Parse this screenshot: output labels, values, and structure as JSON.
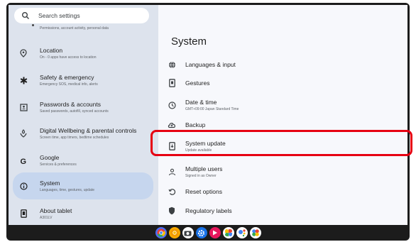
{
  "search": {
    "placeholder": "Search settings"
  },
  "left": {
    "cut_subtitle": "Permissions, account activity, personal data",
    "items": [
      {
        "title": "Location",
        "subtitle": "On - 0 apps have access to location",
        "icon": "location-pin-icon"
      },
      {
        "title": "Safety & emergency",
        "subtitle": "Emergency SOS, medical info, alerts",
        "icon": "asterisk-icon"
      },
      {
        "title": "Passwords & accounts",
        "subtitle": "Saved passwords, autofill, synced accounts",
        "icon": "account-box-icon"
      },
      {
        "title": "Digital Wellbeing & parental controls",
        "subtitle": "Screen time, app timers, bedtime schedules",
        "icon": "wellbeing-icon"
      },
      {
        "title": "Google",
        "subtitle": "Services & preferences",
        "icon": "google-icon"
      },
      {
        "title": "System",
        "subtitle": "Languages, time, gestures, update",
        "icon": "info-icon"
      },
      {
        "title": "About tablet",
        "subtitle": "A301LV",
        "icon": "tablet-icon"
      }
    ]
  },
  "right": {
    "title": "System",
    "items": [
      {
        "title": "Languages & input",
        "subtitle": "",
        "icon": "globe-icon"
      },
      {
        "title": "Gestures",
        "subtitle": "",
        "icon": "gesture-phone-icon"
      },
      {
        "title": "Date & time",
        "subtitle": "GMT+09:00 Japan Standard Time",
        "icon": "clock-icon"
      },
      {
        "title": "Backup",
        "subtitle": "",
        "icon": "cloud-backup-icon"
      },
      {
        "title": "System update",
        "subtitle": "Update available",
        "icon": "system-update-icon"
      },
      {
        "title": "Multiple users",
        "subtitle": "Signed in as Owner",
        "icon": "users-icon"
      },
      {
        "title": "Reset options",
        "subtitle": "",
        "icon": "reset-icon"
      },
      {
        "title": "Regulatory labels",
        "subtitle": "",
        "icon": "shield-icon"
      }
    ]
  },
  "colors": {
    "left_panel": "#dde3ed",
    "selected": "#c6d6ee",
    "highlight": "#e60012",
    "taskbar": "#1c1c1c"
  },
  "taskbar": {
    "apps": [
      "chrome-icon",
      "chrome-canary-icon",
      "camera-icon",
      "settings-app-icon",
      "app-icon-magenta",
      "photos-icon",
      "assistant-icon",
      "drive-icon"
    ]
  }
}
